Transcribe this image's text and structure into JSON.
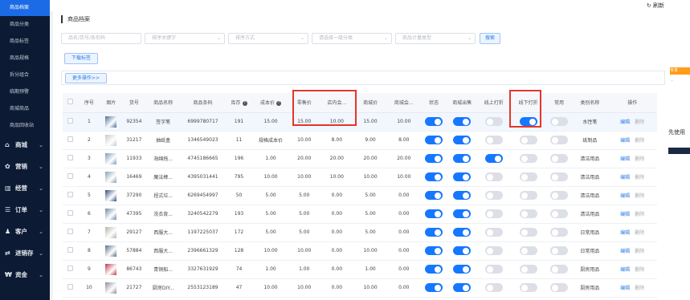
{
  "sidebar": {
    "subitems": [
      {
        "label": "商品档案",
        "active": true
      },
      {
        "label": "商品分类"
      },
      {
        "label": "商品标签"
      },
      {
        "label": "商品规格"
      },
      {
        "label": "拆分组合"
      },
      {
        "label": "临期预警"
      },
      {
        "label": "商城商品"
      },
      {
        "label": "商品回收站"
      }
    ],
    "groups": [
      {
        "label": "商城",
        "icon": "shop-icon"
      },
      {
        "label": "营销",
        "icon": "gift-icon"
      },
      {
        "label": "经营",
        "icon": "bar-chart-icon"
      },
      {
        "label": "订单",
        "icon": "list-icon"
      },
      {
        "label": "客户",
        "icon": "user-icon"
      },
      {
        "label": "进销存",
        "icon": "exchange-icon"
      },
      {
        "label": "资金",
        "icon": "currency-icon"
      }
    ]
  },
  "topbar": {
    "refresh_label": "刷新"
  },
  "page": {
    "title": "商品档案"
  },
  "filters": {
    "search_placeholder": "品名/货号/条形码",
    "sort_keyword": "排序关键字",
    "sort_method": "排序方式",
    "category": "请选择一级分类",
    "measure_type": "商品计量类型",
    "search_button": "搜索"
  },
  "actions": {
    "tag_button": "下载标签",
    "more_button": "更多操作>>"
  },
  "table": {
    "headers": [
      "",
      "序号",
      "图片",
      "货号",
      "商品名称",
      "商品条码",
      "库存",
      "成本价",
      "零售价",
      "店内会...",
      "商城价",
      "商城会...",
      "状态",
      "商城出售",
      "线上打折",
      "线下打折",
      "常用",
      "类别名称",
      "操作"
    ],
    "edit_label": "编辑",
    "delete_label": "删除",
    "rows": [
      {
        "no": "1",
        "sku": "92354",
        "name": "签字笔",
        "barcode": "6999780717",
        "stock": "191",
        "cost": "15.00",
        "retail": "15.00",
        "member": "10.00",
        "mall": "15.00",
        "mall_member": "10.00",
        "status": true,
        "mall_sale": true,
        "online": false,
        "offline": true,
        "common": false,
        "category": "水性笔",
        "thumb": "#4a6d9a"
      },
      {
        "no": "2",
        "sku": "31217",
        "name": "抽纸盒",
        "barcode": "1346549023",
        "stock": "11",
        "cost": "规格成本价",
        "retail": "10.00",
        "member": "8.00",
        "mall": "9.00",
        "mall_member": "8.00",
        "status": true,
        "mall_sale": true,
        "online": false,
        "offline": false,
        "common": false,
        "category": "纸制品",
        "thumb": "#c9c9c9"
      },
      {
        "no": "3",
        "sku": "11933",
        "name": "海绵拖...",
        "barcode": "4745186665",
        "stock": "196",
        "cost": "1.00",
        "retail": "20.00",
        "member": "20.00",
        "mall": "20.00",
        "mall_member": "20.00",
        "status": true,
        "mall_sale": true,
        "online": true,
        "offline": false,
        "common": false,
        "category": "清洁用品",
        "thumb": "#7a9bb8"
      },
      {
        "no": "4",
        "sku": "16469",
        "name": "魔法棒...",
        "barcode": "4395031441",
        "stock": "795",
        "cost": "10.00",
        "retail": "10.00",
        "member": "10.00",
        "mall": "10.00",
        "mall_member": "10.00",
        "status": true,
        "mall_sale": true,
        "online": false,
        "offline": false,
        "common": false,
        "category": "清洁用品",
        "thumb": "#8aa0b3"
      },
      {
        "no": "5",
        "sku": "37290",
        "name": "捏式垃...",
        "barcode": "6269454997",
        "stock": "50",
        "cost": "5.00",
        "retail": "5.00",
        "member": "0.00",
        "mall": "5.00",
        "mall_member": "0.00",
        "status": true,
        "mall_sale": true,
        "online": false,
        "offline": false,
        "common": false,
        "category": "清洁用品",
        "thumb": "#2d4f7a"
      },
      {
        "no": "6",
        "sku": "47395",
        "name": "洗衣背...",
        "barcode": "3240542279",
        "stock": "193",
        "cost": "5.00",
        "retail": "5.00",
        "member": "0.00",
        "mall": "5.00",
        "mall_member": "0.00",
        "status": true,
        "mall_sale": true,
        "online": false,
        "offline": false,
        "common": false,
        "category": "清洁用品",
        "thumb": "#6d8aa6"
      },
      {
        "no": "7",
        "sku": "29127",
        "name": "西服大...",
        "barcode": "1197225037",
        "stock": "172",
        "cost": "5.00",
        "retail": "5.00",
        "member": "0.00",
        "mall": "5.00",
        "mall_member": "0.00",
        "status": true,
        "mall_sale": true,
        "online": false,
        "offline": false,
        "common": false,
        "category": "日常用品",
        "thumb": "#b9b2a8"
      },
      {
        "no": "8",
        "sku": "57884",
        "name": "西服大...",
        "barcode": "2396661329",
        "stock": "128",
        "cost": "10.00",
        "retail": "10.00",
        "member": "0.00",
        "mall": "10.00",
        "mall_member": "0.00",
        "status": true,
        "mall_sale": true,
        "online": false,
        "offline": false,
        "common": false,
        "category": "日常用品",
        "thumb": "#5a6f86"
      },
      {
        "no": "9",
        "sku": "86743",
        "name": "青铜船...",
        "barcode": "3327631929",
        "stock": "74",
        "cost": "1.00",
        "retail": "1.00",
        "member": "0.00",
        "mall": "1.00",
        "mall_member": "0.00",
        "status": true,
        "mall_sale": true,
        "online": false,
        "offline": false,
        "common": false,
        "category": "厨房用品",
        "thumb": "#c03a4a"
      },
      {
        "no": "10",
        "sku": "21727",
        "name": "厨房DIY...",
        "barcode": "2553123189",
        "stock": "47",
        "cost": "10.00",
        "retail": "10.00",
        "member": "0.00",
        "mall": "10.00",
        "mall_member": "0.00",
        "status": true,
        "mall_sale": true,
        "online": false,
        "offline": false,
        "common": false,
        "category": "厨房用品",
        "thumb": "#8a8f96"
      }
    ]
  },
  "right_strip": {
    "badge": "专享",
    "text": "先使用"
  }
}
